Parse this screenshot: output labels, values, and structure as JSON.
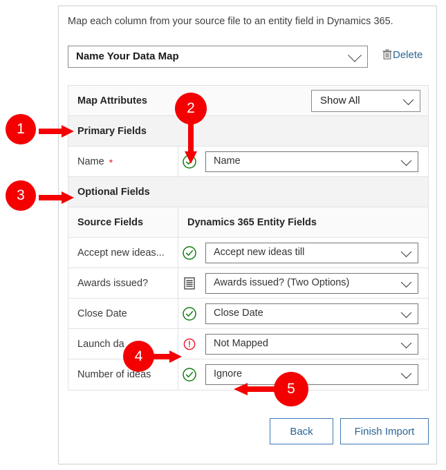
{
  "panel": {
    "instruction": "Map each column from your source file to an entity field in Dynamics 365."
  },
  "map_name": {
    "value": "Name Your Data Map",
    "delete_label": "Delete",
    "trash_icon": "trash-icon",
    "caret_icon": "chevron-down-icon"
  },
  "grid": {
    "attributes_header": {
      "label": "Map Attributes",
      "filter_value": "Show All"
    },
    "primary_section_label": "Primary Fields",
    "primary_rows": [
      {
        "source": "Name",
        "required": "*",
        "status": "valid-check-icon",
        "target": "Name"
      }
    ],
    "optional_section_label": "Optional Fields",
    "column_headers": {
      "source": "Source Fields",
      "target": "Dynamics 365 Entity Fields"
    },
    "optional_rows": [
      {
        "source": "Accept new ideas...",
        "status": "valid-check-icon",
        "target": "Accept new ideas till"
      },
      {
        "source": "Awards issued?",
        "status": "option-set-icon",
        "target": "Awards issued? (Two Options)"
      },
      {
        "source": "Close Date",
        "status": "valid-check-icon",
        "target": "Close Date"
      },
      {
        "source": "Launch da",
        "status": "error-icon",
        "target": "Not Mapped"
      },
      {
        "source": "Number of ideas",
        "status": "valid-check-icon",
        "target": "Ignore"
      }
    ]
  },
  "footer": {
    "back_label": "Back",
    "finish_label": "Finish Import"
  },
  "callouts": [
    {
      "number": "1"
    },
    {
      "number": "2"
    },
    {
      "number": "3"
    },
    {
      "number": "4"
    },
    {
      "number": "5"
    }
  ],
  "colors": {
    "callout_red": "#f40000",
    "link_blue": "#2a6496",
    "button_border_blue": "#3b78b5",
    "success_green": "#107c10",
    "error_red": "#e81123",
    "required_star": "#e81123"
  }
}
